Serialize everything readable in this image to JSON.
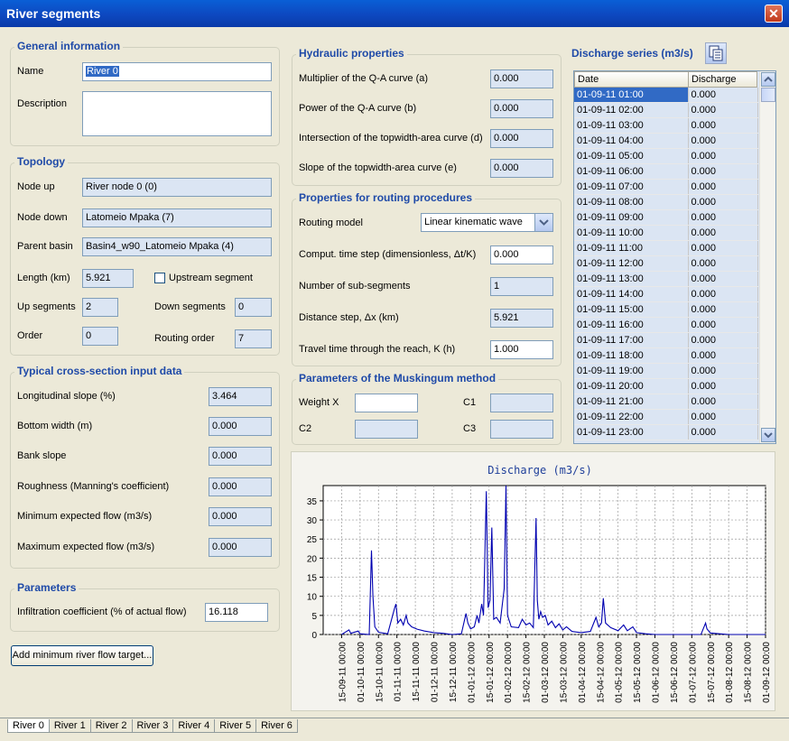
{
  "window": {
    "title": "River segments",
    "close_glyph": "✕"
  },
  "general": {
    "title": "General information",
    "name_label": "Name",
    "name_value": "River 0",
    "description_label": "Description",
    "description_value": ""
  },
  "topology": {
    "title": "Topology",
    "node_up_label": "Node up",
    "node_up_value": "River node 0 (0)",
    "node_down_label": "Node down",
    "node_down_value": "Latomeio Mpaka (7)",
    "parent_basin_label": "Parent basin",
    "parent_basin_value": "Basin4_w90_Latomeio Mpaka (4)",
    "length_label": "Length (km)",
    "length_value": "5.921",
    "upstream_label": "Upstream segment",
    "upstream_checked": false,
    "up_segments_label": "Up segments",
    "up_segments_value": "2",
    "down_segments_label": "Down segments",
    "down_segments_value": "0",
    "order_label": "Order",
    "order_value": "0",
    "routing_order_label": "Routing order",
    "routing_order_value": "7"
  },
  "cross_section": {
    "title": "Typical cross-section input data",
    "rows": [
      {
        "label": "Longitudinal slope (%)",
        "value": "3.464"
      },
      {
        "label": "Bottom width (m)",
        "value": "0.000"
      },
      {
        "label": "Bank slope",
        "value": "0.000"
      },
      {
        "label": "Roughness (Manning's coefficient)",
        "value": "0.000"
      },
      {
        "label": "Minimum expected flow (m3/s)",
        "value": "0.000"
      },
      {
        "label": "Maximum expected flow (m3/s)",
        "value": "0.000"
      }
    ]
  },
  "parameters": {
    "title": "Parameters",
    "infiltration_label": "Infiltration coefficient (% of actual flow)",
    "infiltration_value": "16.118"
  },
  "add_target_button": "Add minimum river flow target...",
  "hydraulic": {
    "title": "Hydraulic properties",
    "rows": [
      {
        "label": "Multiplier of the Q-A curve (a)",
        "value": "0.000"
      },
      {
        "label": "Power of the Q-A curve (b)",
        "value": "0.000"
      },
      {
        "label": "Intersection of the topwidth-area curve (d)",
        "value": "0.000"
      },
      {
        "label": "Slope of the topwidth-area curve (e)",
        "value": "0.000"
      }
    ]
  },
  "routing": {
    "title": "Properties for routing procedures",
    "model_label": "Routing model",
    "model_value": "Linear kinematic wave",
    "timestep_label": "Comput. time step (dimensionless, Δt/K)",
    "timestep_value": "0.000",
    "subsegments_label": "Number of sub-segments",
    "subsegments_value": "1",
    "distance_label": "Distance step, Δx (km)",
    "distance_value": "5.921",
    "travel_label": "Travel time through the reach, K (h)",
    "travel_value": "1.000"
  },
  "muskingum": {
    "title": "Parameters of the Muskingum method",
    "weight_label": "Weight X",
    "weight_value": "",
    "c1_label": "C1",
    "c1_value": "",
    "c2_label": "C2",
    "c2_value": "",
    "c3_label": "C3",
    "c3_value": ""
  },
  "discharge_series": {
    "title": "Discharge series (m3/s)",
    "col_date": "Date",
    "col_discharge": "Discharge",
    "rows": [
      [
        "01-09-11 01:00",
        "0.000"
      ],
      [
        "01-09-11 02:00",
        "0.000"
      ],
      [
        "01-09-11 03:00",
        "0.000"
      ],
      [
        "01-09-11 04:00",
        "0.000"
      ],
      [
        "01-09-11 05:00",
        "0.000"
      ],
      [
        "01-09-11 06:00",
        "0.000"
      ],
      [
        "01-09-11 07:00",
        "0.000"
      ],
      [
        "01-09-11 08:00",
        "0.000"
      ],
      [
        "01-09-11 09:00",
        "0.000"
      ],
      [
        "01-09-11 10:00",
        "0.000"
      ],
      [
        "01-09-11 11:00",
        "0.000"
      ],
      [
        "01-09-11 12:00",
        "0.000"
      ],
      [
        "01-09-11 13:00",
        "0.000"
      ],
      [
        "01-09-11 14:00",
        "0.000"
      ],
      [
        "01-09-11 15:00",
        "0.000"
      ],
      [
        "01-09-11 16:00",
        "0.000"
      ],
      [
        "01-09-11 17:00",
        "0.000"
      ],
      [
        "01-09-11 18:00",
        "0.000"
      ],
      [
        "01-09-11 19:00",
        "0.000"
      ],
      [
        "01-09-11 20:00",
        "0.000"
      ],
      [
        "01-09-11 21:00",
        "0.000"
      ],
      [
        "01-09-11 22:00",
        "0.000"
      ],
      [
        "01-09-11 23:00",
        "0.000"
      ]
    ]
  },
  "tabs": [
    "River 0",
    "River 1",
    "River 2",
    "River 3",
    "River 4",
    "River 5",
    "River 6"
  ],
  "colors": {
    "series": "#0000b0",
    "title_blue": "#1f4aa8",
    "readonly": "#dbe5f3"
  },
  "chart_data": {
    "type": "line",
    "title": "Discharge (m3/s)",
    "xlabel": "",
    "ylabel": "",
    "ylim": [
      0,
      39
    ],
    "grid": true,
    "yticks": [
      0,
      5,
      10,
      15,
      20,
      25,
      30,
      35
    ],
    "x_ticks": [
      "15-09-11 00:00",
      "01-10-11 00:00",
      "15-10-11 00:00",
      "01-11-11 00:00",
      "15-11-11 00:00",
      "01-12-11 00:00",
      "15-12-11 00:00",
      "01-01-12 00:00",
      "15-01-12 00:00",
      "01-02-12 00:00",
      "15-02-12 00:00",
      "01-03-12 00:00",
      "15-03-12 00:00",
      "01-04-12 00:00",
      "15-04-12 00:00",
      "01-05-12 00:00",
      "15-05-12 00:00",
      "01-06-12 00:00",
      "15-06-12 00:00",
      "01-07-12 00:00",
      "15-07-12 00:00",
      "01-08-12 00:00",
      "15-08-12 00:00",
      "01-09-12 00:00"
    ],
    "series": [
      {
        "values": [
          [
            0.0,
            0
          ],
          [
            0.4,
            1.2
          ],
          [
            0.5,
            0.3
          ],
          [
            0.9,
            0.9
          ],
          [
            1.0,
            0.2
          ],
          [
            1.5,
            0
          ],
          [
            1.62,
            22
          ],
          [
            1.7,
            10
          ],
          [
            1.8,
            2
          ],
          [
            2.0,
            0.6
          ],
          [
            2.5,
            0.2
          ],
          [
            2.88,
            7
          ],
          [
            2.95,
            8
          ],
          [
            3.05,
            3
          ],
          [
            3.2,
            4
          ],
          [
            3.35,
            2.5
          ],
          [
            3.5,
            5
          ],
          [
            3.6,
            3
          ],
          [
            3.8,
            2
          ],
          [
            4.1,
            1.4
          ],
          [
            4.5,
            0.9
          ],
          [
            5.0,
            0.5
          ],
          [
            5.5,
            0.3
          ],
          [
            6.0,
            0
          ],
          [
            6.5,
            0.2
          ],
          [
            6.75,
            5.5
          ],
          [
            6.85,
            3
          ],
          [
            7.0,
            1.5
          ],
          [
            7.2,
            2
          ],
          [
            7.35,
            5
          ],
          [
            7.45,
            3
          ],
          [
            7.6,
            8
          ],
          [
            7.7,
            5
          ],
          [
            7.85,
            37.5
          ],
          [
            7.95,
            7
          ],
          [
            8.05,
            9
          ],
          [
            8.15,
            28
          ],
          [
            8.25,
            4
          ],
          [
            8.4,
            4.5
          ],
          [
            8.6,
            3
          ],
          [
            8.82,
            12
          ],
          [
            8.92,
            39
          ],
          [
            9.0,
            5
          ],
          [
            9.2,
            2
          ],
          [
            9.6,
            1.8
          ],
          [
            9.8,
            4
          ],
          [
            10.0,
            2.5
          ],
          [
            10.2,
            3
          ],
          [
            10.4,
            1.8
          ],
          [
            10.55,
            30.5
          ],
          [
            10.62,
            9
          ],
          [
            10.7,
            4
          ],
          [
            10.8,
            6
          ],
          [
            10.9,
            4.5
          ],
          [
            11.05,
            5
          ],
          [
            11.2,
            2.5
          ],
          [
            11.4,
            3.5
          ],
          [
            11.6,
            1.8
          ],
          [
            11.8,
            2.8
          ],
          [
            12.0,
            1.2
          ],
          [
            12.2,
            2
          ],
          [
            12.5,
            0.8
          ],
          [
            13.0,
            0.5
          ],
          [
            13.5,
            0.8
          ],
          [
            13.8,
            4.5
          ],
          [
            13.95,
            2
          ],
          [
            14.1,
            3
          ],
          [
            14.2,
            9.5
          ],
          [
            14.32,
            3
          ],
          [
            14.6,
            1.8
          ],
          [
            15.0,
            1
          ],
          [
            15.3,
            2.5
          ],
          [
            15.5,
            1
          ],
          [
            15.8,
            2
          ],
          [
            16.0,
            0.5
          ],
          [
            16.5,
            0.2
          ],
          [
            17.0,
            0
          ],
          [
            18.0,
            0
          ],
          [
            19.0,
            0
          ],
          [
            19.5,
            0
          ],
          [
            19.75,
            3
          ],
          [
            19.82,
            1.5
          ],
          [
            20.0,
            0.4
          ],
          [
            20.5,
            0.2
          ],
          [
            21.0,
            0
          ],
          [
            22.0,
            0
          ],
          [
            23.0,
            0
          ]
        ]
      }
    ]
  }
}
